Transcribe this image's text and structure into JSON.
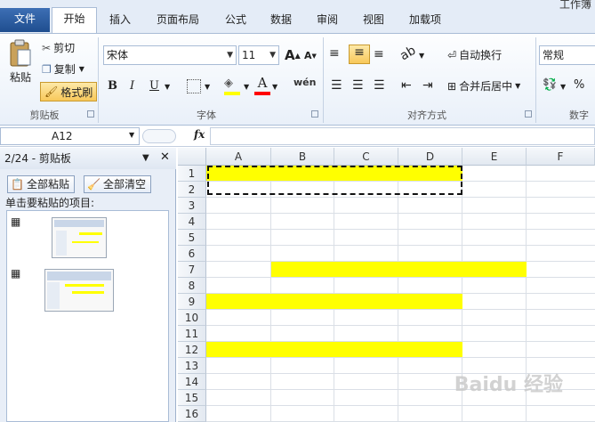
{
  "window": {
    "title_fragment": "工作簿"
  },
  "tabs": [
    {
      "label": "文件",
      "id": "file"
    },
    {
      "label": "开始",
      "id": "home"
    },
    {
      "label": "插入",
      "id": "insert"
    },
    {
      "label": "页面布局",
      "id": "layout"
    },
    {
      "label": "公式",
      "id": "formulas"
    },
    {
      "label": "数据",
      "id": "data"
    },
    {
      "label": "审阅",
      "id": "review"
    },
    {
      "label": "视图",
      "id": "view"
    },
    {
      "label": "加载项",
      "id": "addins"
    }
  ],
  "clipboard_group": {
    "label": "剪贴板",
    "paste": "粘贴",
    "cut": "剪切",
    "copy": "复制",
    "format_painter": "格式刷"
  },
  "font_group": {
    "label": "字体",
    "font_name": "宋体",
    "font_size": "11",
    "bold": "B",
    "italic": "I",
    "underline": "U",
    "phonetic": "wén",
    "grow": "A",
    "shrink": "A",
    "font_color": "#ff0000",
    "fill_color": "#ffff00"
  },
  "alignment_group": {
    "label": "对齐方式",
    "wrap_text": "自动换行",
    "merge_center": "合并后居中"
  },
  "number_group": {
    "label": "数字",
    "format": "常规",
    "percent": "%"
  },
  "formula_bar": {
    "name_box": "A12",
    "fx": "fx",
    "value": ""
  },
  "clipboard_pane": {
    "title": "2/24 - 剪贴板",
    "paste_all": "全部粘贴",
    "clear_all": "全部清空",
    "hint": "单击要粘贴的项目:",
    "item_count": 2
  },
  "sheet": {
    "columns": [
      "A",
      "B",
      "C",
      "D",
      "E",
      "F"
    ],
    "rows": [
      "1",
      "2",
      "3",
      "4",
      "5",
      "6",
      "7",
      "8",
      "9",
      "10",
      "11",
      "12",
      "13",
      "14",
      "15",
      "16"
    ],
    "highlight_color": "#ffff00",
    "highlighted_ranges": [
      {
        "row": "1",
        "from_col": "A",
        "to_col": "D"
      },
      {
        "row": "7",
        "from_col": "B",
        "to_col": "E"
      },
      {
        "row": "9",
        "from_col": "A",
        "to_col": "D"
      },
      {
        "row": "12",
        "from_col": "A",
        "to_col": "D"
      }
    ],
    "copy_marquee": "A1:D2"
  },
  "watermark": "Baidu 经验"
}
